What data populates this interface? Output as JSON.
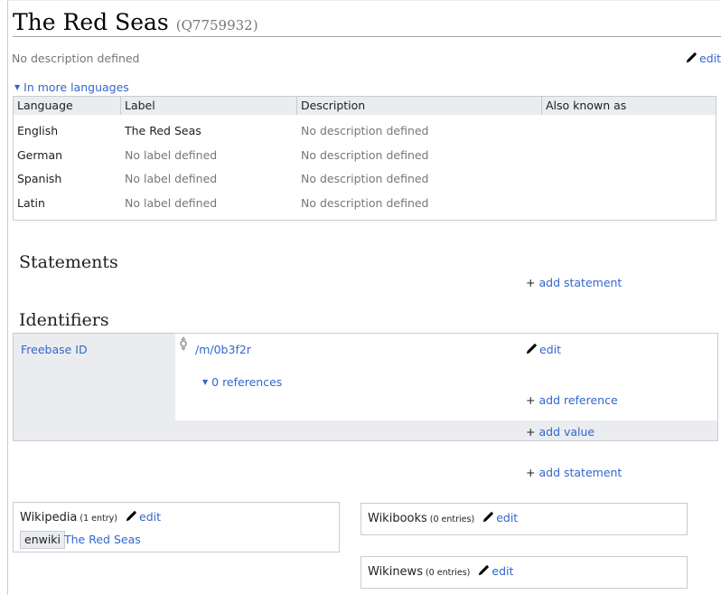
{
  "entity": {
    "label": "The Red Seas",
    "id": "(Q7759932)",
    "description": "No description defined",
    "edit_label": "edit"
  },
  "languages": {
    "toggle_label": "In more languages",
    "columns": [
      "Language",
      "Label",
      "Description",
      "Also known as"
    ],
    "rows": [
      {
        "language": "English",
        "label": "The Red Seas",
        "description": "No description defined",
        "aliases": ""
      },
      {
        "language": "German",
        "label": "No label defined",
        "description": "No description defined",
        "aliases": ""
      },
      {
        "language": "Spanish",
        "label": "No label defined",
        "description": "No description defined",
        "aliases": ""
      },
      {
        "language": "Latin",
        "label": "No label defined",
        "description": "No description defined",
        "aliases": ""
      }
    ]
  },
  "statements": {
    "heading": "Statements",
    "add_statement_label": "add statement"
  },
  "identifiers": {
    "heading": "Identifiers",
    "property": "Freebase ID",
    "value": "/m/0b3f2r",
    "edit_label": "edit",
    "references_toggle": "0 references",
    "add_reference_label": "add reference",
    "add_value_label": "add value",
    "add_statement_label": "add statement"
  },
  "sitelinks": {
    "wikipedia": {
      "name": "Wikipedia",
      "count": "(1 entry)",
      "edit_label": "edit",
      "site_id": "enwiki",
      "page": "The Red Seas"
    },
    "wikibooks": {
      "name": "Wikibooks",
      "count": "(0 entries)",
      "edit_label": "edit"
    },
    "wikinews": {
      "name": "Wikinews",
      "count": "(0 entries)",
      "edit_label": "edit"
    }
  },
  "colors": {
    "link": "#3366cc",
    "muted": "#72777d",
    "header_bg": "#eaecf0",
    "border": "#c8ccd1"
  }
}
